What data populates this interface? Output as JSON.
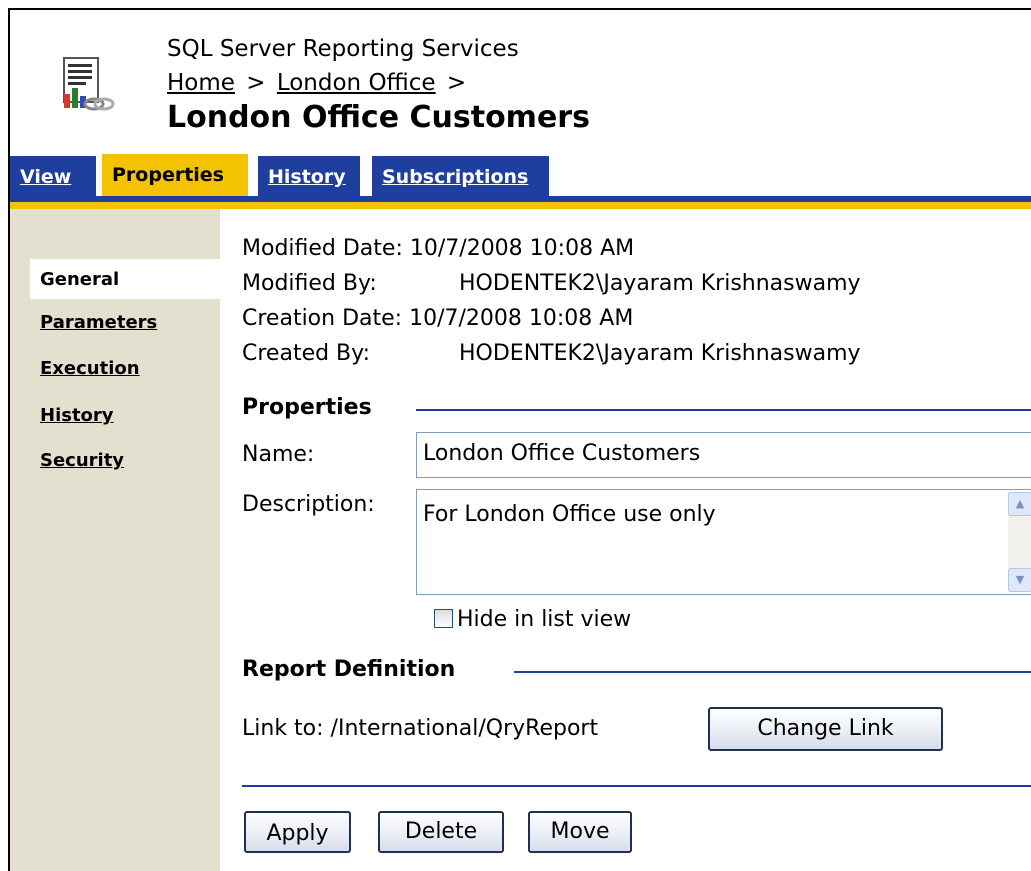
{
  "header": {
    "app_title": "SQL Server Reporting Services",
    "breadcrumb": {
      "home": "Home",
      "sep1": ">",
      "folder": "London Office",
      "sep2": ">"
    },
    "page_title": "London Office Customers"
  },
  "tabs": [
    {
      "label": "View",
      "active": false
    },
    {
      "label": "Properties",
      "active": true
    },
    {
      "label": "History",
      "active": false
    },
    {
      "label": "Subscriptions",
      "active": false
    }
  ],
  "sidebar": {
    "items": [
      {
        "label": "General",
        "selected": true
      },
      {
        "label": "Parameters",
        "selected": false
      },
      {
        "label": "Execution",
        "selected": false
      },
      {
        "label": "History",
        "selected": false
      },
      {
        "label": "Security",
        "selected": false
      }
    ]
  },
  "meta": {
    "modified_date_label": "Modified Date:",
    "modified_date": "10/7/2008 10:08 AM",
    "modified_by_label": "Modified By:",
    "modified_by": "HODENTEK2\\Jayaram Krishnaswamy",
    "creation_date_label": "Creation Date:",
    "creation_date": "10/7/2008 10:08 AM",
    "created_by_label": "Created By:",
    "created_by": "HODENTEK2\\Jayaram Krishnaswamy"
  },
  "properties": {
    "heading": "Properties",
    "name_label": "Name:",
    "name_value": "London Office Customers",
    "description_label": "Description:",
    "description_value": "For London Office use only",
    "hide_label": "Hide in list view",
    "hide_checked": false
  },
  "report_definition": {
    "heading": "Report Definition",
    "link_label": "Link to:",
    "link_path": "/International/QryReport",
    "change_link_label": "Change Link"
  },
  "actions": {
    "apply_label": "Apply",
    "delete_label": "Delete",
    "move_label": "Move"
  },
  "colors": {
    "tab_blue": "#1f3f9e",
    "tab_gold": "#f3c200",
    "sidebar_bg": "#e4e0cf"
  }
}
